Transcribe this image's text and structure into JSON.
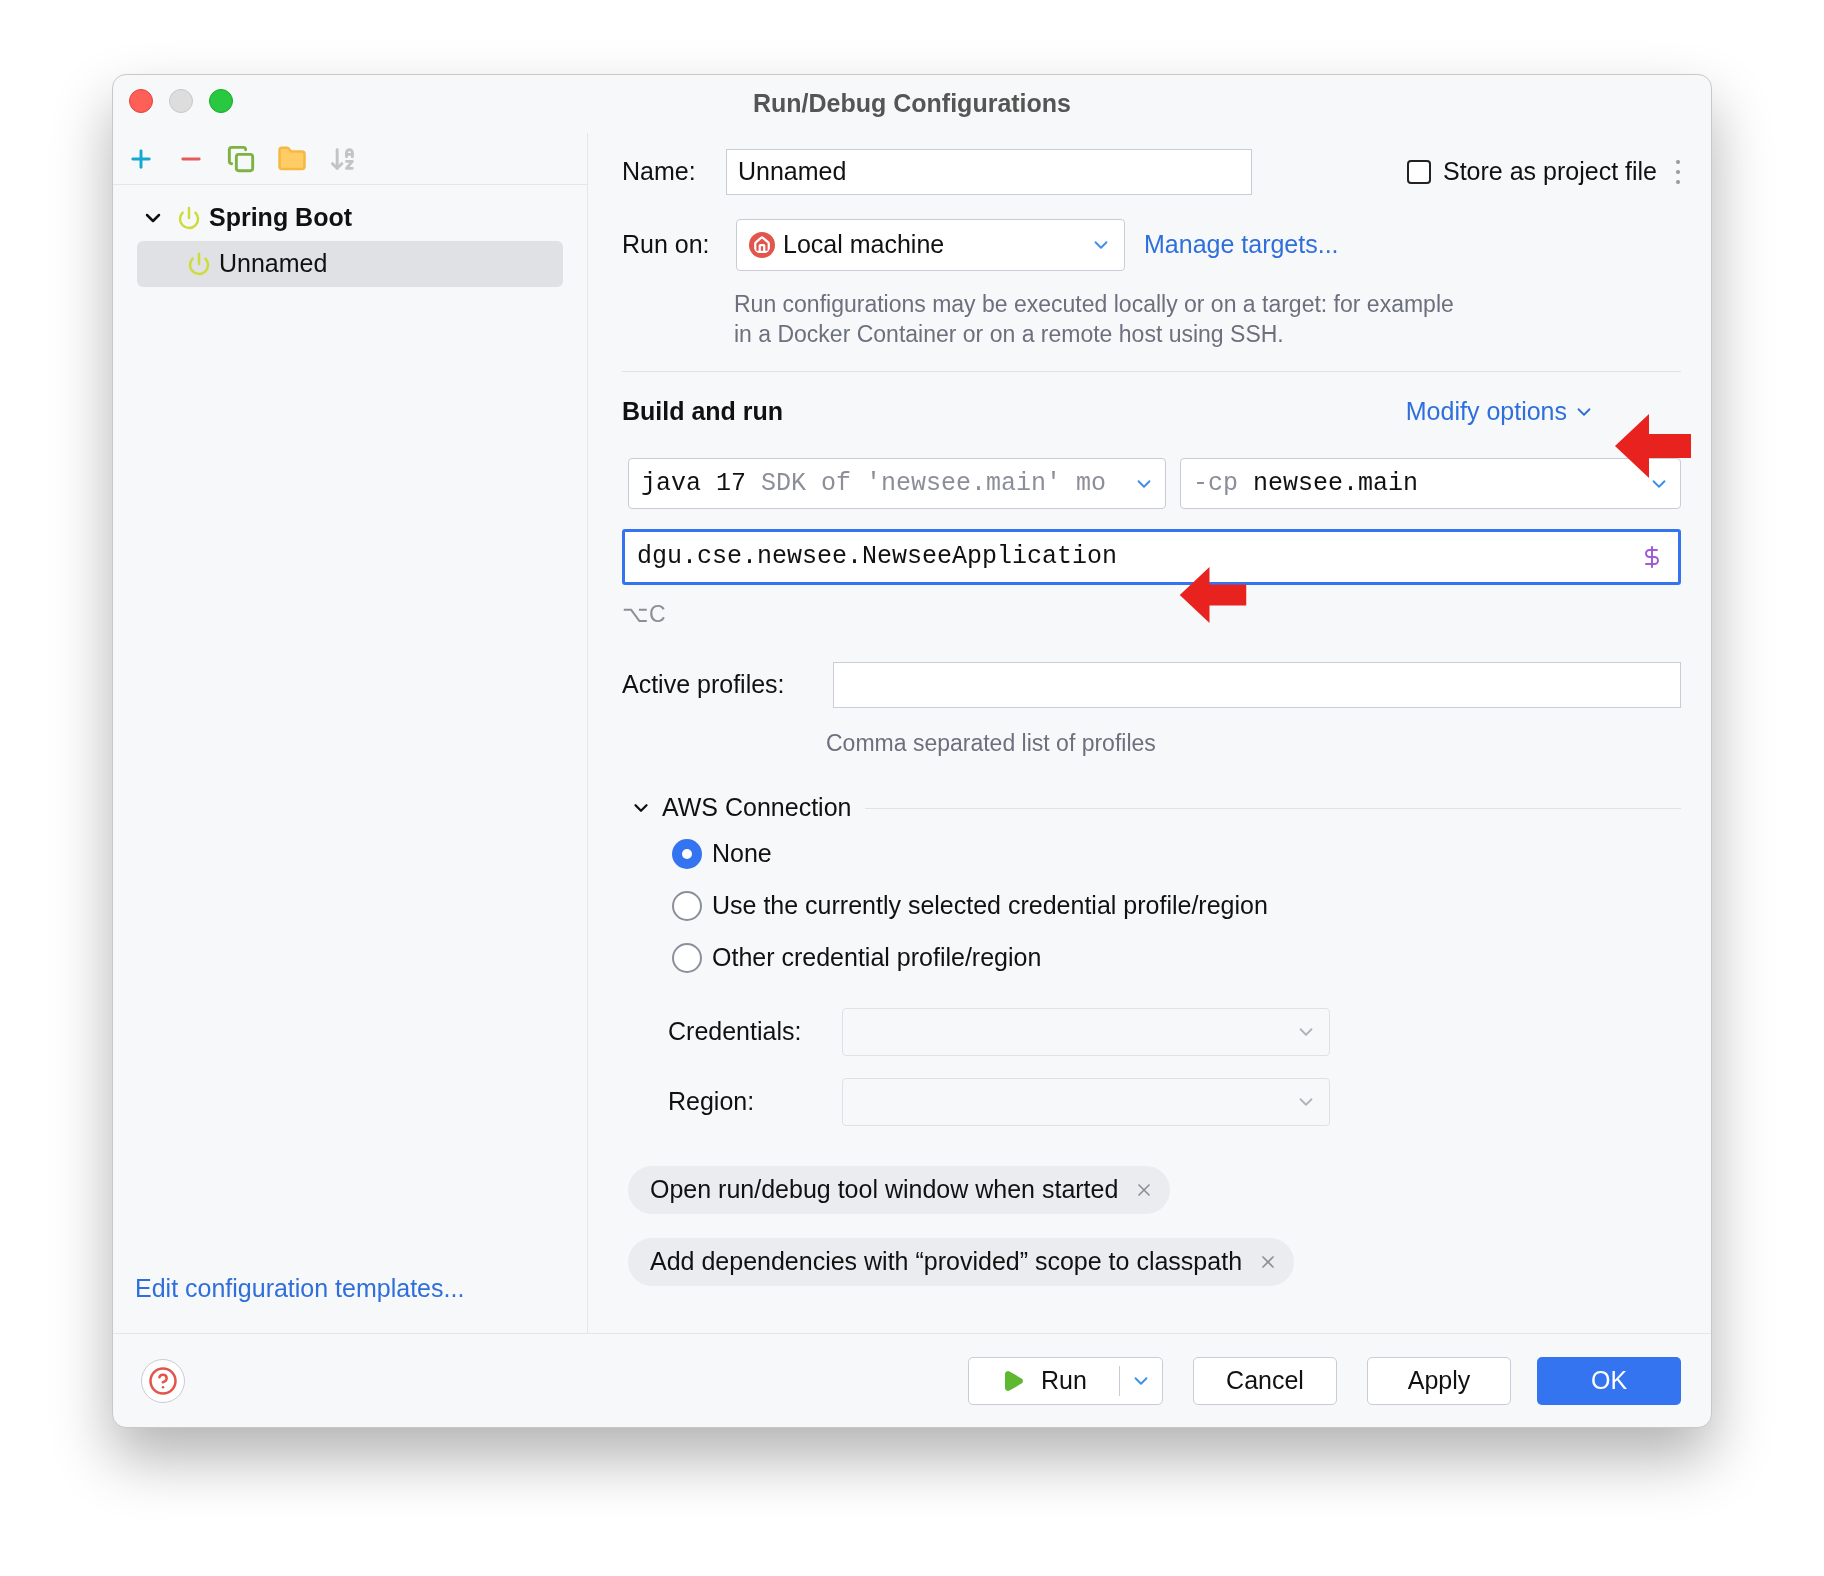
{
  "window": {
    "title": "Run/Debug Configurations"
  },
  "tree": [
    {
      "label": "Spring Boot",
      "expanded": true,
      "selected": false,
      "children": [
        {
          "label": "Unnamed",
          "selected": true
        }
      ]
    }
  ],
  "edit_templates_link": "Edit configuration templates...",
  "name": {
    "label": "Name:",
    "value": "Unnamed"
  },
  "store_as_project_file": {
    "label": "Store as project file",
    "checked": false
  },
  "run_on": {
    "label": "Run on:",
    "value": "Local machine",
    "link": "Manage targets...",
    "hint": "Run configurations may be executed locally or on a target: for example in a Docker Container or on a remote host using SSH."
  },
  "build_and_run": {
    "title": "Build and run",
    "modify_options": "Modify options",
    "jdk": {
      "value": "java 17",
      "hint": "SDK of 'newsee.main' mo"
    },
    "classpath": {
      "prefix": "-cp",
      "value": "newsee.main"
    },
    "main_class": {
      "value": "dgu.cse.newsee.NewseeApplication",
      "focused": true
    },
    "shortcut": "⌥C"
  },
  "active_profiles": {
    "label": "Active profiles:",
    "hint": "Comma separated list of profiles"
  },
  "aws_connection": {
    "title": "AWS Connection",
    "expanded": true,
    "options": [
      {
        "label": "None",
        "selected": true
      },
      {
        "label": "Use the currently selected credential profile/region",
        "selected": false
      },
      {
        "label": "Other credential profile/region",
        "selected": false
      }
    ],
    "credentials": {
      "label": "Credentials:"
    },
    "region": {
      "label": "Region:"
    }
  },
  "option_chips": [
    "Open run/debug tool window when started",
    "Add dependencies with “provided” scope to classpath"
  ],
  "buttons": [
    {
      "kind": "run",
      "label": "Run"
    },
    {
      "kind": "default",
      "label": "Cancel"
    },
    {
      "kind": "default",
      "label": "Apply"
    },
    {
      "kind": "primary",
      "label": "OK"
    }
  ]
}
